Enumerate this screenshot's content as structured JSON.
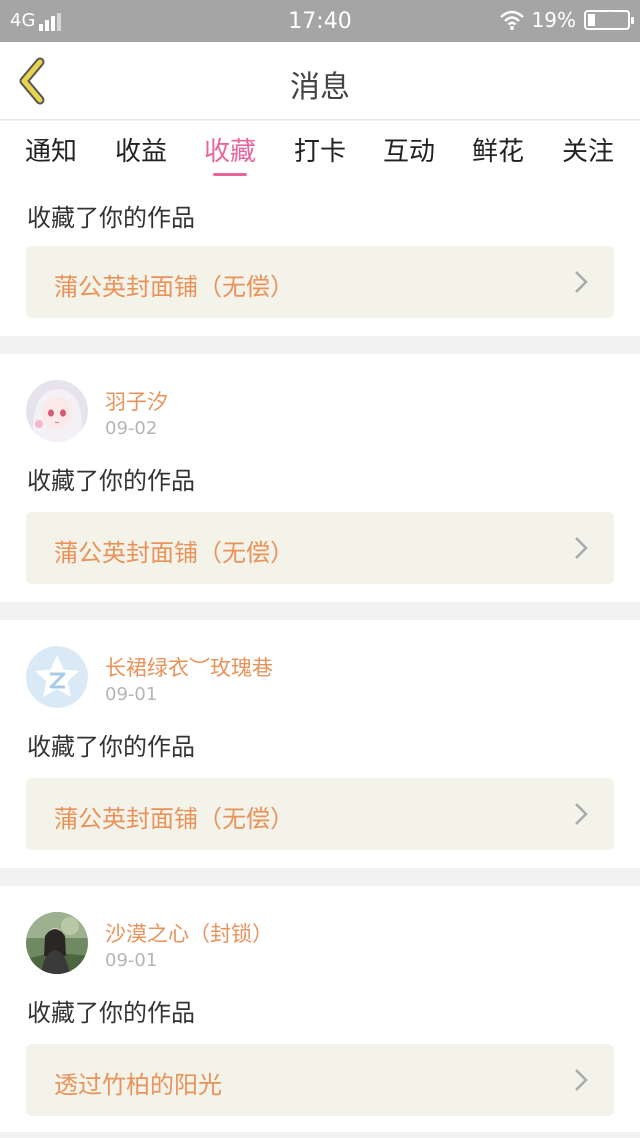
{
  "status": {
    "network": "4G",
    "time": "17:40",
    "battery": "19%",
    "battery_level": 0.19
  },
  "header": {
    "title": "消息"
  },
  "tabs": [
    {
      "label": "通知"
    },
    {
      "label": "收益"
    },
    {
      "label": "收藏"
    },
    {
      "label": "打卡"
    },
    {
      "label": "互动"
    },
    {
      "label": "鲜花"
    },
    {
      "label": "关注"
    }
  ],
  "active_tab": "收藏",
  "items": [
    {
      "action": "收藏了你的作品",
      "work": "蒲公英封面铺（无偿）"
    },
    {
      "user": "羽子汐",
      "date": "09-02",
      "action": "收藏了你的作品",
      "work": "蒲公英封面铺（无偿）",
      "avatar": "anime-girl-avatar"
    },
    {
      "user": "长裙绿衣︶玫瑰巷",
      "date": "09-01",
      "action": "收藏了你的作品",
      "work": "蒲公英封面铺（无偿）",
      "avatar": "default-star-avatar"
    },
    {
      "user": "沙漠之心（封锁）",
      "date": "09-01",
      "action": "收藏了你的作品",
      "work": "透过竹柏的阳光",
      "avatar": "photo-avatar"
    }
  ],
  "colors": {
    "accent": "#e8659e",
    "orange": "#e9935b",
    "card_bg": "#f3f3ea",
    "back_arrow": "#e8d44b"
  }
}
